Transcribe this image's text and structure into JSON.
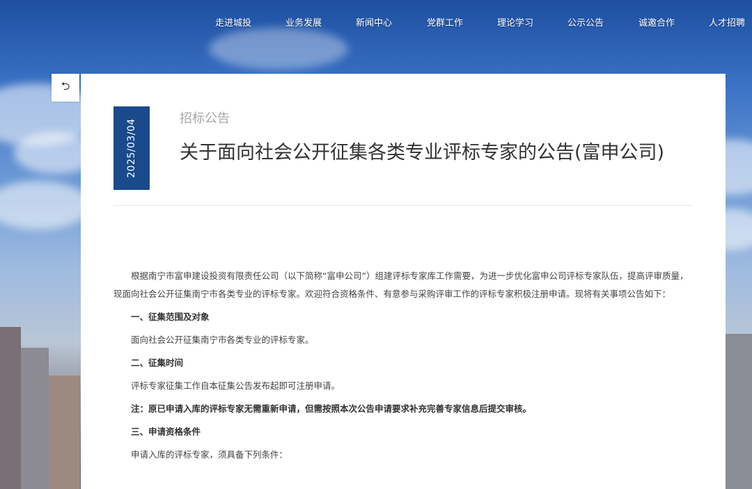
{
  "nav": {
    "items": [
      "走进城投",
      "业务发展",
      "新闻中心",
      "党群工作",
      "理论学习",
      "公示公告",
      "诚邀合作",
      "人才招聘"
    ]
  },
  "back": {
    "icon": "back-arrow-icon",
    "glyph": "⮌"
  },
  "article": {
    "date": "2025/03/04",
    "category": "招标公告",
    "title": "关于面向社会公开征集各类专业评标专家的公告(富申公司)",
    "paragraphs": {
      "intro": "根据南宁市富申建设投资有限责任公司（以下简称“富申公司”）组建评标专家库工作需要，为进一步优化富申公司评标专家队伍，提高评审质量，现面向社会公开征集南宁市各类专业的评标专家。欢迎符合资格条件、有意参与采购评审工作的评标专家积极注册申请。现将有关事项公告如下：",
      "h1": "一、征集范围及对象",
      "p1": "面向社会公开征集南宁市各类专业的评标专家。",
      "h2": "二、征集时间",
      "p2": "评标专家征集工作自本征集公告发布起即可注册申请。",
      "note": "注：原已申请入库的评标专家无需重新申请，但需按照本次公告申请要求补充完善专家信息后提交审核。",
      "h3": "三、申请资格条件",
      "p3": "申请入库的评标专家，须具备下列条件："
    }
  },
  "colors": {
    "accent": "#1a4a8c",
    "panel": "#ffffff"
  }
}
